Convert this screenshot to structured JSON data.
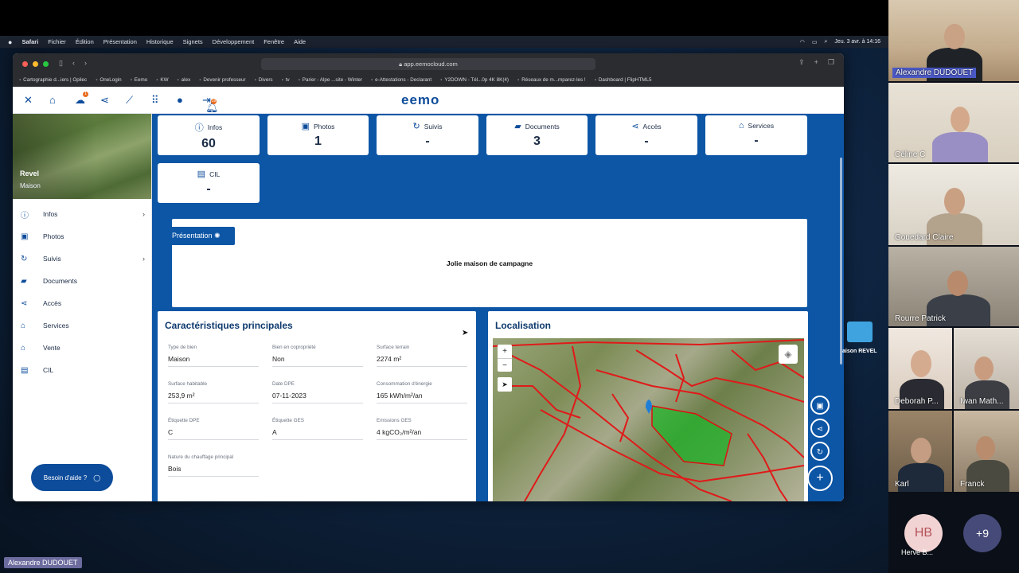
{
  "menubar": {
    "apple": "",
    "app": "Safari",
    "items": [
      "Fichier",
      "Édition",
      "Présentation",
      "Historique",
      "Signets",
      "Développement",
      "Fenêtre",
      "Aide"
    ],
    "datetime": "Jeu. 3 avr. à 14:16"
  },
  "browser": {
    "url": "app.eemocloud.com",
    "bookmarks": [
      "Cartographie d...iers | Opilec",
      "OneLogin",
      "Eemo",
      "KW",
      "alex",
      "Devenir professeur",
      "Divers",
      "tv",
      "Parier - Alpe ...site - Winter",
      "e-Attestations - Declarant",
      "Y2DOWN - Tél...0p 4K 8K(4)",
      "Réseaux de m...mparez-les !",
      "Dashboard | FlipHTML5"
    ]
  },
  "app": {
    "logo": "eemo",
    "upload_badge": "1",
    "bell_badge": "19"
  },
  "property": {
    "city": "Revel",
    "type": "Maison"
  },
  "sidebar": {
    "items": [
      {
        "label": "Infos",
        "icon": "info-icon",
        "chevron": "›"
      },
      {
        "label": "Photos",
        "icon": "image-icon"
      },
      {
        "label": "Suivis",
        "icon": "history-icon",
        "chevron": "›"
      },
      {
        "label": "Documents",
        "icon": "folder-icon"
      },
      {
        "label": "Accès",
        "icon": "share-icon"
      },
      {
        "label": "Services",
        "icon": "house-gear-icon"
      },
      {
        "label": "Vente",
        "icon": "house-sale-icon"
      },
      {
        "label": "CIL",
        "icon": "book-icon"
      }
    ],
    "help": "Besoin d'aide ?"
  },
  "cards": [
    {
      "label": "Infos",
      "value": "60"
    },
    {
      "label": "Photos",
      "value": "1"
    },
    {
      "label": "Suivis",
      "value": "-"
    },
    {
      "label": "Documents",
      "value": "3"
    },
    {
      "label": "Accès",
      "value": "-"
    },
    {
      "label": "Services",
      "value": "-"
    },
    {
      "label": "CIL",
      "value": "-"
    }
  ],
  "presentation": {
    "tag": "Présentation",
    "text": "Jolie maison de campagne"
  },
  "caracteristiques": {
    "title": "Caractéristiques principales",
    "fields": [
      {
        "label": "Type de bien",
        "value": "Maison"
      },
      {
        "label": "Bien en copropriété",
        "value": "Non"
      },
      {
        "label": "Surface terrain",
        "value": "2274 m²"
      },
      {
        "label": "Surface habitable",
        "value": "253,9 m²"
      },
      {
        "label": "Date DPE",
        "value": "07-11-2023"
      },
      {
        "label": "Consommation d'énergie",
        "value": "165 kWh/m²/an"
      },
      {
        "label": "Étiquette DPE",
        "value": "C"
      },
      {
        "label": "Étiquette GES",
        "value": "A"
      },
      {
        "label": "Emissions GES",
        "value": "4 kgCO₂/m²/an"
      },
      {
        "label": "Nature du chauffage principal",
        "value": "Bois"
      }
    ]
  },
  "localisation": {
    "title": "Localisation",
    "zoom_in": "+",
    "zoom_out": "−"
  },
  "desktop": {
    "folder_label": "aison REVEL",
    "presenter": "Alexandre DUDOUET"
  },
  "participants": [
    {
      "name": "Alexandre DUDOUET"
    },
    {
      "name": "Céline C"
    },
    {
      "name": "Gouedard Claire"
    },
    {
      "name": "Rourre Patrick"
    },
    {
      "name": "Deborah P..."
    },
    {
      "name": "Iwan Math..."
    },
    {
      "name": "Karl"
    },
    {
      "name": "Franck"
    },
    {
      "name": "Hervé B...",
      "initials": "HB"
    },
    {
      "name": "",
      "initials": "+9"
    }
  ]
}
